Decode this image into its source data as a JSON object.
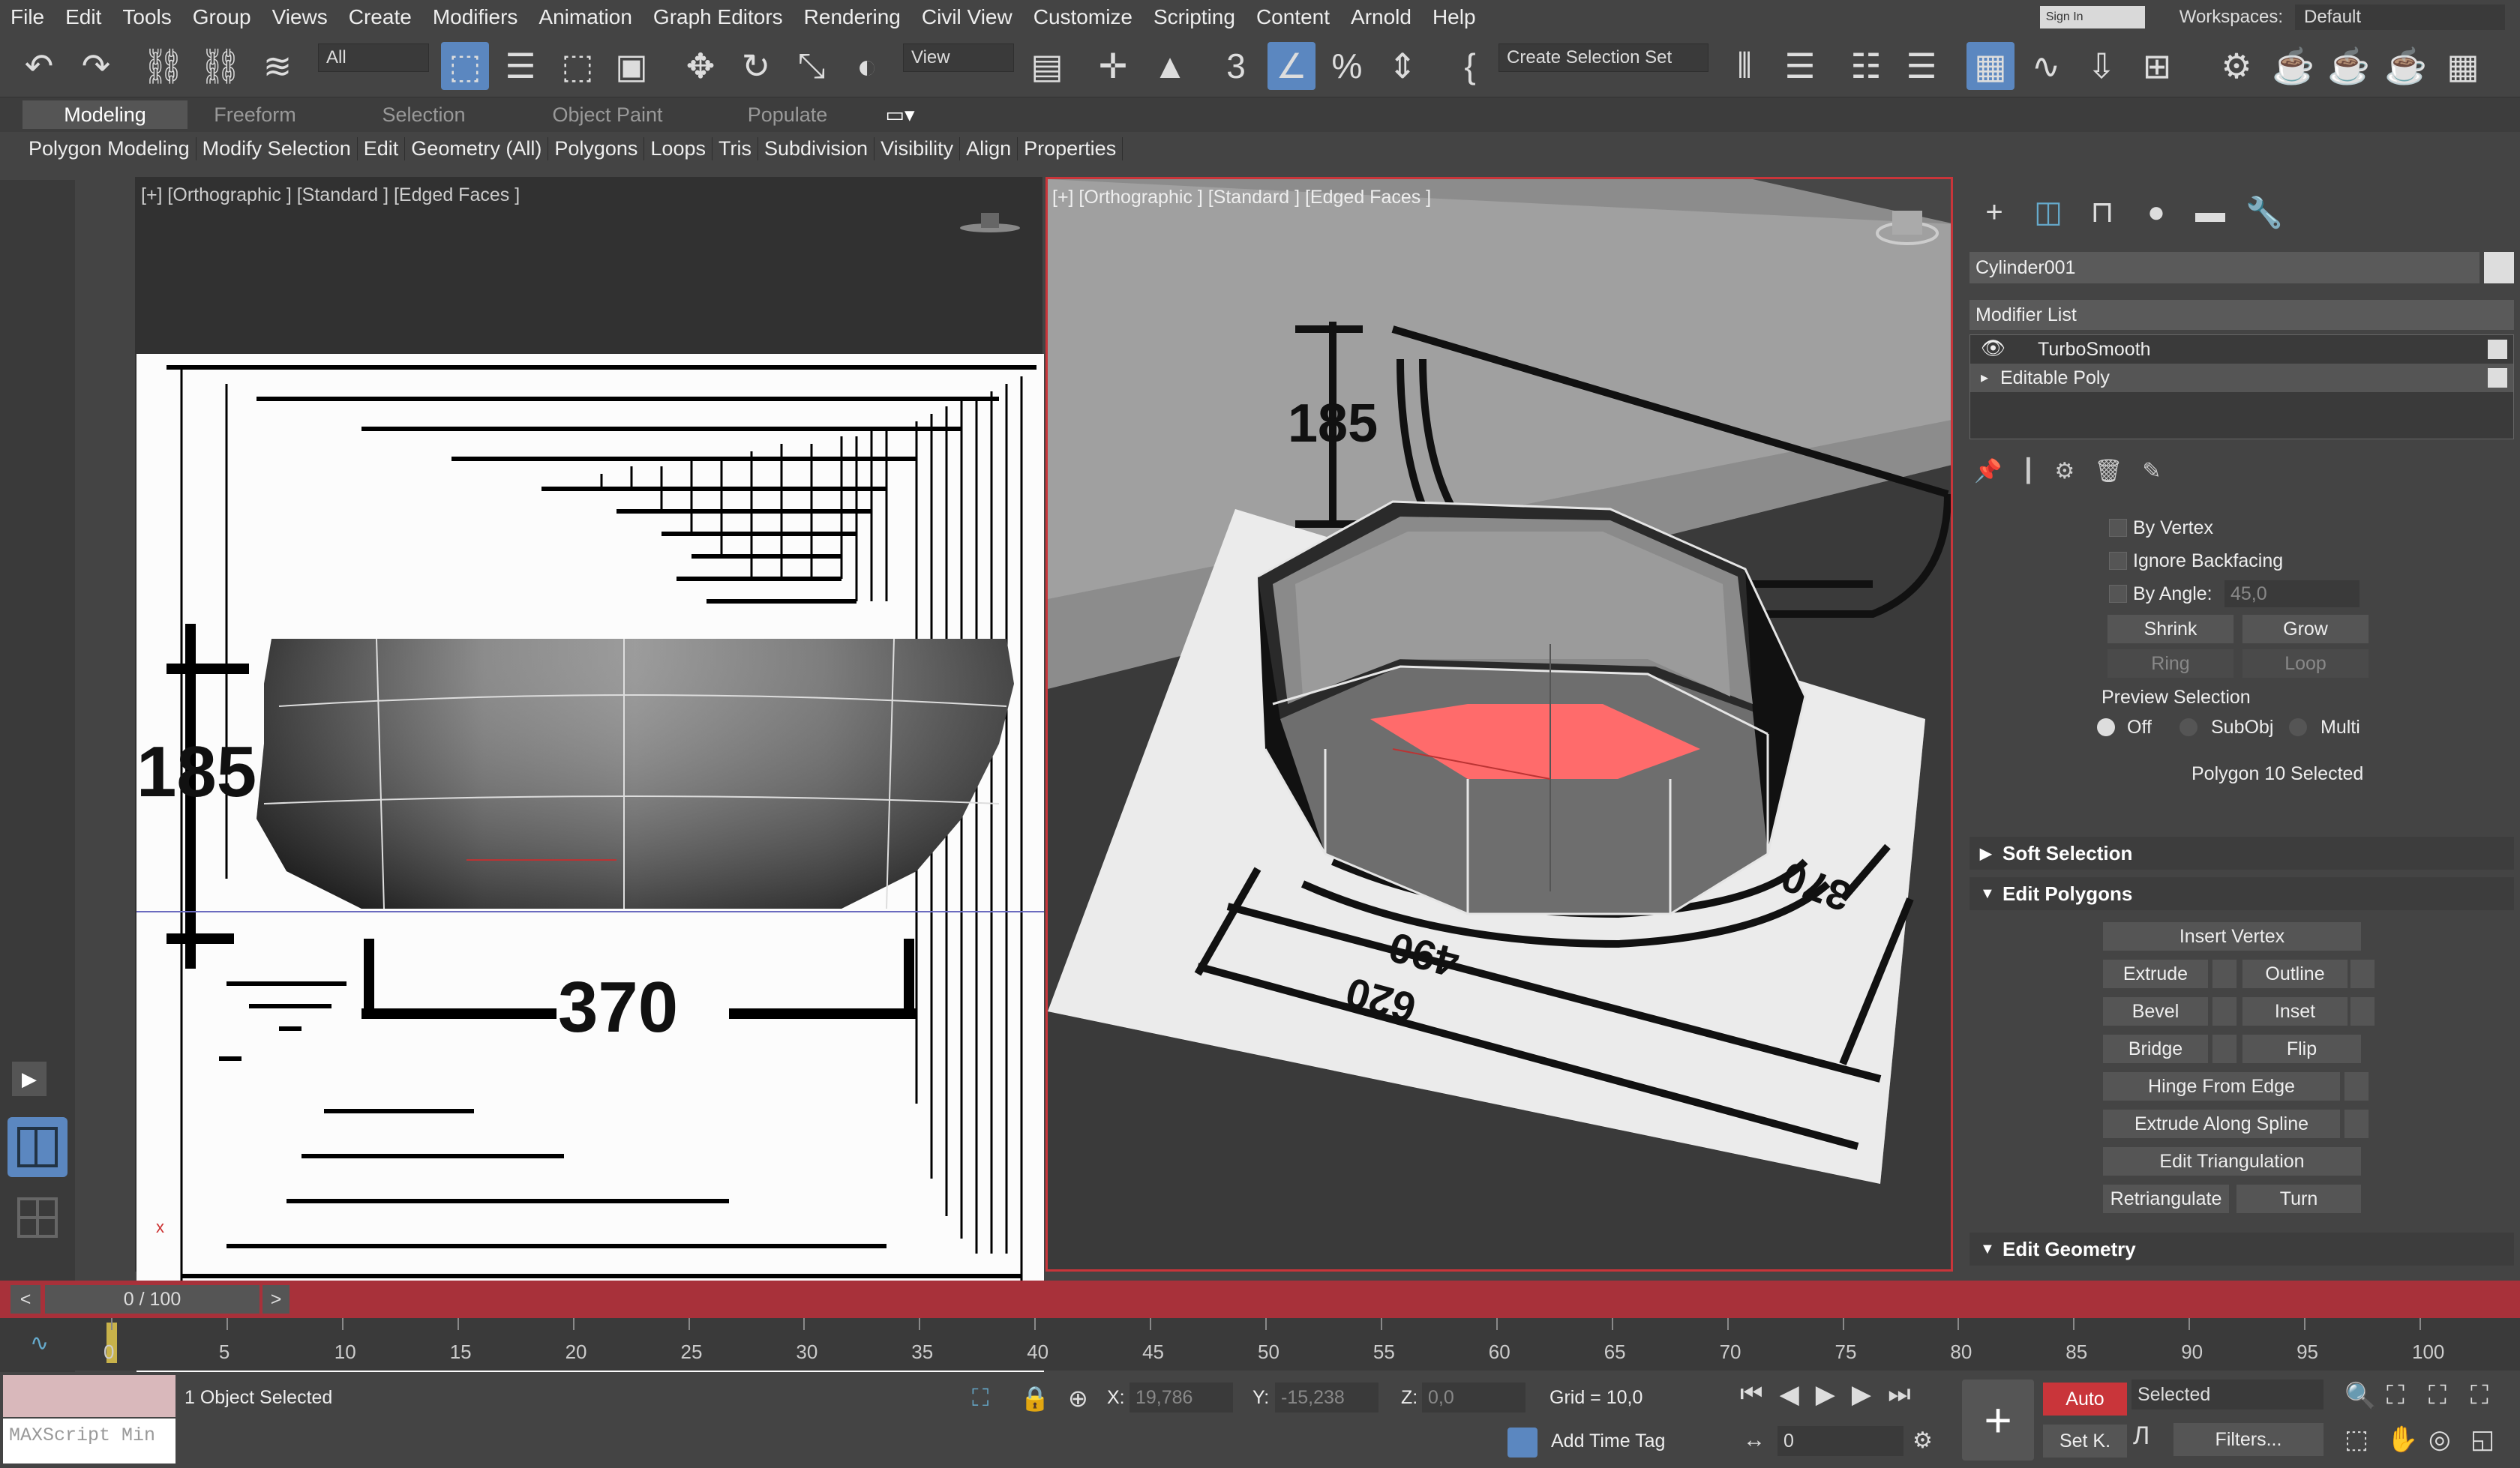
{
  "menu": [
    "File",
    "Edit",
    "Tools",
    "Group",
    "Views",
    "Create",
    "Modifiers",
    "Animation",
    "Graph Editors",
    "Rendering",
    "Civil View",
    "Customize",
    "Scripting",
    "Content",
    "Arnold",
    "Help"
  ],
  "signin": "Sign In",
  "workspaces_label": "Workspaces:",
  "workspace_value": "Default",
  "toolbar": {
    "filter": "All",
    "coord": "View",
    "selset": "Create Selection Set"
  },
  "ribbon_tabs": [
    "Modeling",
    "Freeform",
    "Selection",
    "Object Paint",
    "Populate"
  ],
  "ribbon_sub": [
    "Polygon Modeling",
    "Modify Selection",
    "Edit",
    "Geometry (All)",
    "Polygons",
    "Loops",
    "Tris",
    "Subdivision",
    "Visibility",
    "Align",
    "Properties"
  ],
  "viewport_left": {
    "label": "[+] [Orthographic ] [Standard ] [Edged Faces ]",
    "dim_height": "185",
    "dim_width": "370"
  },
  "viewport_right": {
    "label": "[+] [Orthographic ] [Standard ] [Edged Faces ]",
    "dim_height": "185",
    "dim_370": "370",
    "dim_490": "490",
    "dim_620": "620"
  },
  "command_panel": {
    "object_name": "Cylinder001",
    "modifier_list": "Modifier List",
    "stack": [
      "TurboSmooth",
      "Editable Poly"
    ],
    "by_vertex": "By Vertex",
    "ignore_backfacing": "Ignore Backfacing",
    "by_angle": "By Angle:",
    "angle_value": "45,0",
    "shrink": "Shrink",
    "grow": "Grow",
    "ring": "Ring",
    "loop": "Loop",
    "preview_selection": "Preview Selection",
    "radio_off": "Off",
    "radio_subobj": "SubObj",
    "radio_multi": "Multi",
    "selected_status": "Polygon 10 Selected",
    "soft_selection": "Soft Selection",
    "edit_polygons": "Edit Polygons",
    "insert_vertex": "Insert Vertex",
    "extrude": "Extrude",
    "outline": "Outline",
    "bevel": "Bevel",
    "inset": "Inset",
    "bridge": "Bridge",
    "flip": "Flip",
    "hinge_from_edge": "Hinge From Edge",
    "extrude_along_spline": "Extrude Along Spline",
    "edit_triangulation": "Edit Triangulation",
    "retriangulate": "Retriangulate",
    "turn": "Turn",
    "edit_geometry": "Edit Geometry"
  },
  "time": {
    "frame": "0 / 100",
    "ticks": [
      "0",
      "5",
      "10",
      "15",
      "20",
      "25",
      "30",
      "35",
      "40",
      "45",
      "50",
      "55",
      "60",
      "65",
      "70",
      "75",
      "80",
      "85",
      "90",
      "95",
      "100"
    ]
  },
  "status": {
    "maxscript": "MAXScript Min",
    "objects_selected": "1 Object Selected",
    "x_label": "X:",
    "x_value": "19,786",
    "y_label": "Y:",
    "y_value": "-15,238",
    "z_label": "Z:",
    "z_value": "0,0",
    "grid": "Grid = 10,0",
    "add_time_tag": "Add Time Tag",
    "auto": "Auto",
    "setk": "Set K.",
    "selected": "Selected",
    "filters": "Filters...",
    "frame_field": "0"
  },
  "colors": {
    "accent": "#5b87c0",
    "timeline": "#a8313a",
    "selected_face": "#ff6b6b"
  }
}
